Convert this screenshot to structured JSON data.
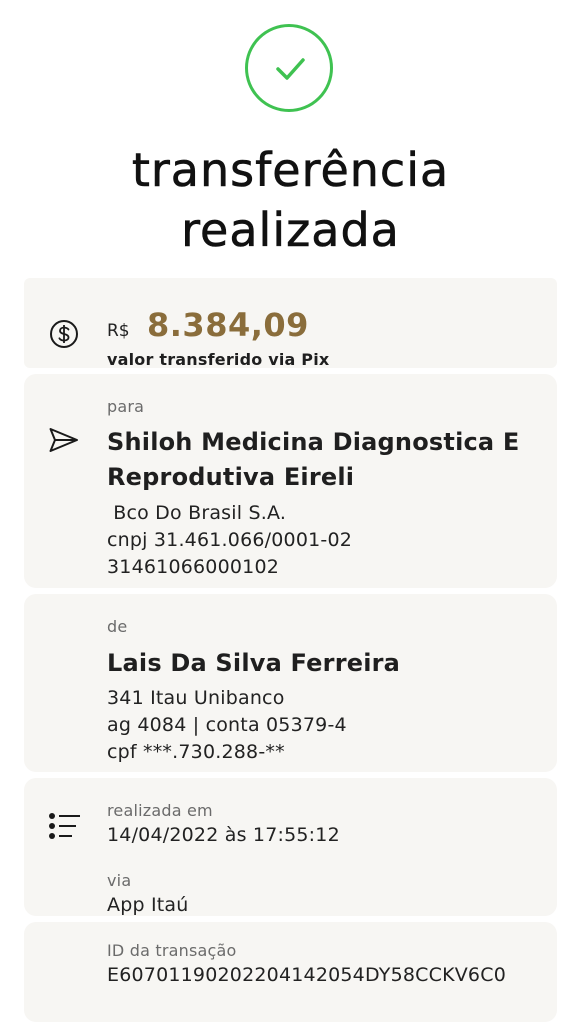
{
  "header": {
    "title_line1": "transferência",
    "title_line2": "realizada",
    "success_icon": "check-circle-icon",
    "success_color": "#3fc251"
  },
  "value": {
    "icon": "dollar-circle-icon",
    "currency": "R$",
    "amount": "8.384,09",
    "amount_color": "#8a6d3b",
    "description": "valor transferido via Pix"
  },
  "recipient": {
    "icon": "send-icon",
    "label": "para",
    "name_line1": "Shiloh Medicina Diagnostica E",
    "name_line2": "Reprodutiva Eireli",
    "bank": " Bco Do Brasil S.A.",
    "cnpj": "cnpj 31.461.066/0001-02",
    "account": "31461066000102"
  },
  "sender": {
    "label": "de",
    "name": "Lais Da Silva Ferreira",
    "bank": "341 Itau Unibanco",
    "agency_account": "ag 4084 | conta 05379-4",
    "cpf": "cpf ***.730.288-**"
  },
  "details": {
    "icon": "list-icon",
    "date_label": "realizada em",
    "date_value": "14/04/2022 às 17:55:12",
    "channel_label": "via",
    "channel_value": "App Itaú",
    "id_label": "ID da transação",
    "id_value": "E60701190202204142054DY58CCKV6C0"
  }
}
